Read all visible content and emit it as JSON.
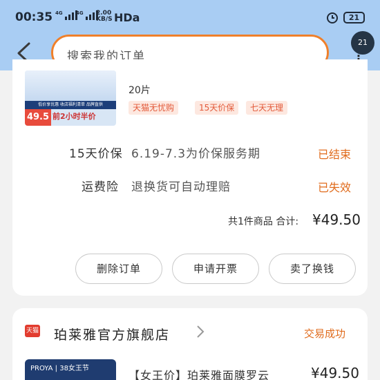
{
  "status_bar": {
    "time": "00:35",
    "network_1": "4G",
    "network_2": "4G",
    "speed_value": "2.00",
    "speed_unit": "KB/S",
    "hd": "HDa",
    "battery": "21"
  },
  "search": {
    "placeholder": "搜索我的订单"
  },
  "fab": {
    "label": "21"
  },
  "order1": {
    "thumb_band": "低价享优惠 收店福利清单 品牌直供",
    "thumb_price": "49.5",
    "thumb_tag": "前2小时半价",
    "pieces": "20片",
    "tags": [
      "天猫无忧购",
      "15天价保",
      "七天无理"
    ],
    "rows": [
      {
        "label": "15天价保",
        "value": "6.19-7.3为价保服务期",
        "status": "已结束"
      },
      {
        "label": "运费险",
        "value": "退换货可自动理赔",
        "status": "已失效"
      }
    ],
    "total_label": "共1件商品 合计:",
    "total_price": "¥49.50",
    "buttons": [
      "删除订单",
      "申请开票",
      "卖了换钱"
    ]
  },
  "order2": {
    "platform_badge": "天猫",
    "shop_name": "珀莱雅官方旗舰店",
    "status": "交易成功",
    "thumb_text": "PROYA | 38女王节",
    "product": "【女王价】珀莱雅面膜罗云",
    "price": "¥49.50"
  }
}
